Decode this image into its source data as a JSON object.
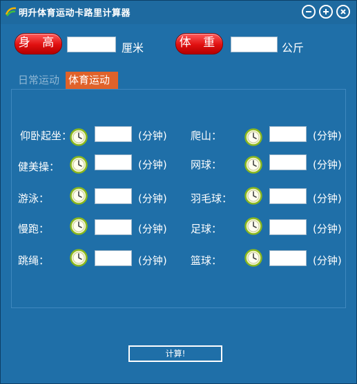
{
  "window": {
    "title": "明升体育运动卡路里计算器"
  },
  "header": {
    "height_button": "身 高",
    "height_unit": "厘米",
    "weight_button": "体 重",
    "weight_unit": "公斤"
  },
  "tabs": [
    {
      "label": "日常运动",
      "active": false
    },
    {
      "label": "体育运动",
      "active": true
    }
  ],
  "sports_left": [
    "仰卧起坐：",
    "健美操：",
    "游泳：",
    "慢跑：",
    "跳绳："
  ],
  "sports_right": [
    "爬山：",
    "网球：",
    "羽毛球：",
    "足球：",
    "篮球："
  ],
  "minute_unit": "(分钟)",
  "calc_button": "计算!",
  "colors": {
    "background": "#1f6fa8",
    "active_tab": "#e0622a",
    "red_button": "#e01010"
  },
  "icons": {
    "clock": "clock-icon",
    "minimize": "minimize-icon",
    "maximize": "maximize-icon",
    "close": "close-icon"
  }
}
